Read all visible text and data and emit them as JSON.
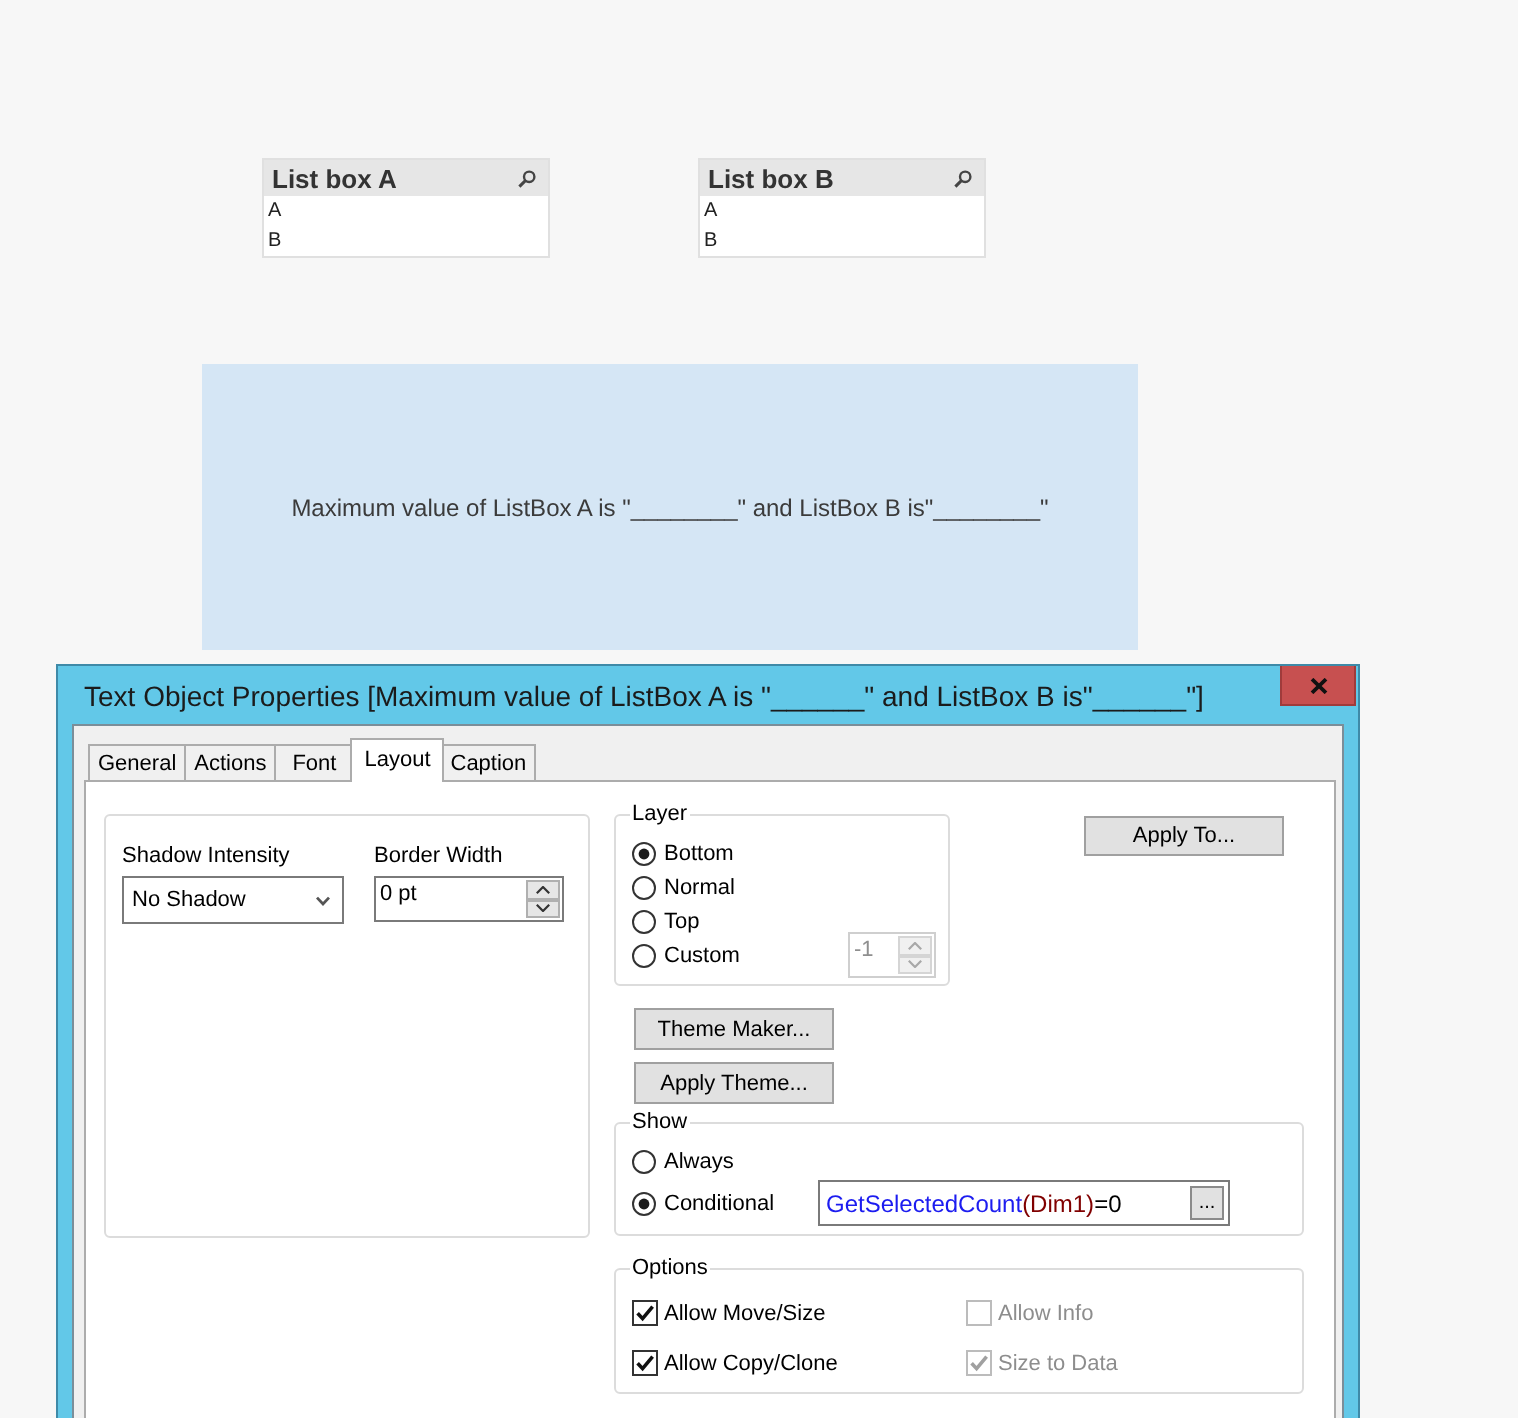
{
  "list_boxes": [
    {
      "title": "List box A",
      "items": [
        "A",
        "B"
      ]
    },
    {
      "title": "List box B",
      "items": [
        "A",
        "B"
      ]
    }
  ],
  "text_object": {
    "text": "Maximum value of ListBox A is \"________\" and ListBox B is\"________\""
  },
  "dialog": {
    "title": "Text Object Properties [Maximum value of ListBox A is \"______\" and ListBox B is\"______\"]",
    "tabs": [
      {
        "label": "General",
        "selected": false
      },
      {
        "label": "Actions",
        "selected": false
      },
      {
        "label": "Font",
        "selected": false
      },
      {
        "label": "Layout",
        "selected": true
      },
      {
        "label": "Caption",
        "selected": false
      }
    ],
    "shadow_intensity": {
      "label": "Shadow Intensity",
      "value": "No Shadow"
    },
    "border_width": {
      "label": "Border Width",
      "value": "0 pt"
    },
    "layer": {
      "legend": "Layer",
      "options": [
        {
          "label": "Bottom",
          "selected": true
        },
        {
          "label": "Normal",
          "selected": false
        },
        {
          "label": "Top",
          "selected": false
        },
        {
          "label": "Custom",
          "selected": false
        }
      ],
      "custom_value": {
        "value": "-1",
        "disabled": true
      }
    },
    "apply_to_button": "Apply To...",
    "theme_buttons": [
      "Theme Maker...",
      "Apply Theme..."
    ],
    "show": {
      "legend": "Show",
      "options": [
        {
          "label": "Always",
          "selected": false
        },
        {
          "label": "Conditional",
          "selected": true
        }
      ],
      "condition": [
        {
          "text": "GetSelectedCount",
          "color": "#1c1cf0"
        },
        {
          "text": "(Dim1)",
          "color": "#800000"
        },
        {
          "text": "=0",
          "color": "#000000"
        }
      ],
      "browse_button": "..."
    },
    "options": {
      "legend": "Options",
      "items": [
        {
          "label": "Allow Move/Size",
          "checked": true,
          "disabled": false
        },
        {
          "label": "Allow Info",
          "checked": false,
          "disabled": true
        },
        {
          "label": "Allow Copy/Clone",
          "checked": true,
          "disabled": false
        },
        {
          "label": "Size to Data",
          "checked": true,
          "disabled": true
        }
      ]
    }
  }
}
